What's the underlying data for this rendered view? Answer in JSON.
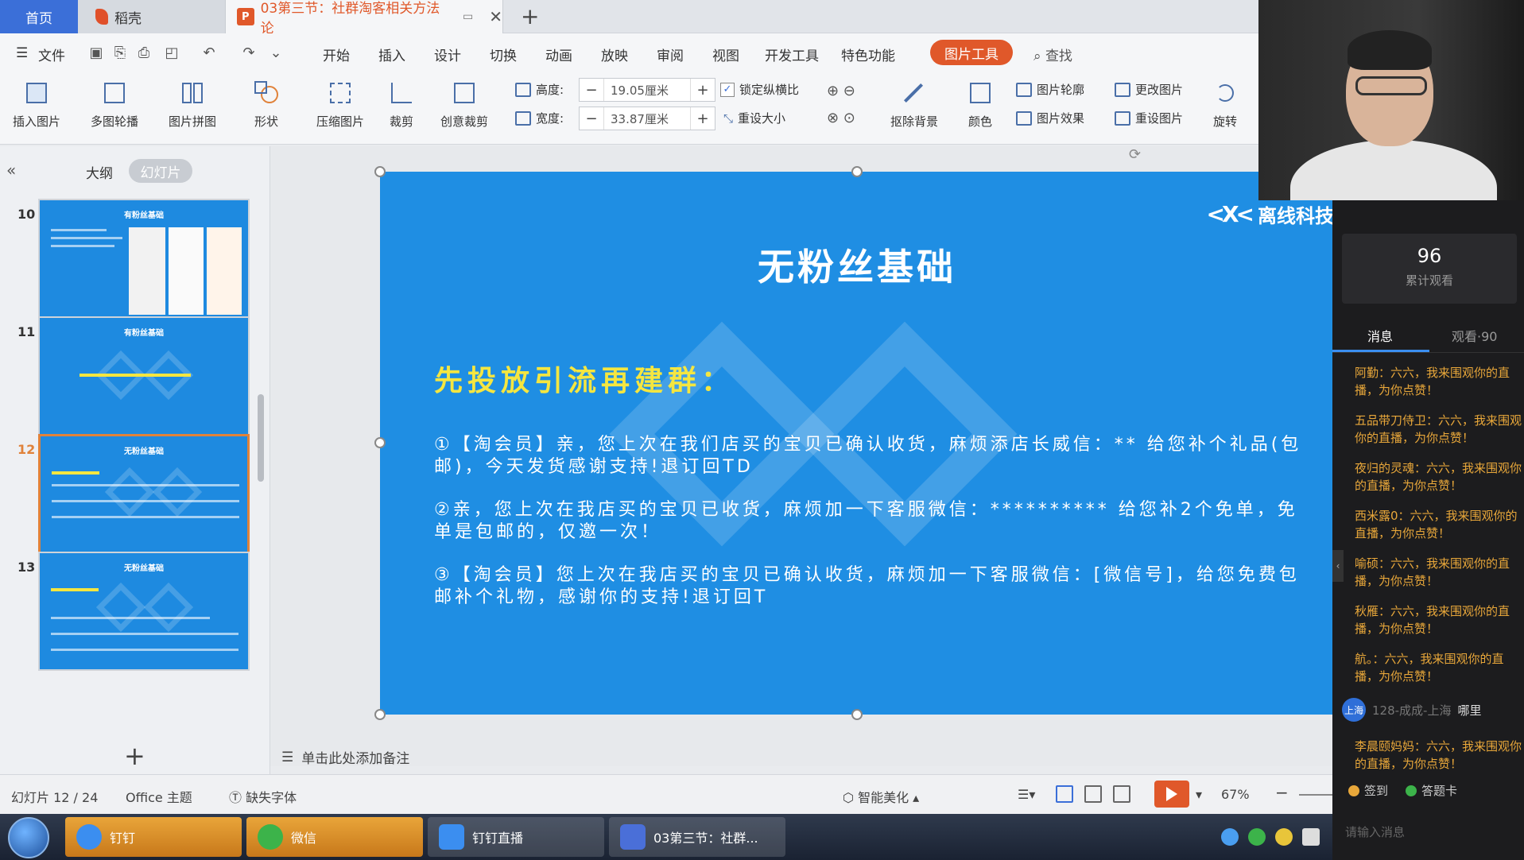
{
  "tabs": {
    "home": "首页",
    "daoke": "稻壳",
    "doc": "03第三节：社群淘客相关方法论",
    "doc_badge": "P"
  },
  "menu": {
    "file": "文件",
    "tabs": [
      "开始",
      "插入",
      "设计",
      "切换",
      "动画",
      "放映",
      "审阅",
      "视图",
      "开发工具",
      "特色功能"
    ],
    "picture_tool": "图片工具",
    "search": "查找"
  },
  "ribbon": {
    "insert_picture": "插入图片",
    "multi_carousel": "多图轮播",
    "picture_collage": "图片拼图",
    "shape": "形状",
    "compress": "压缩图片",
    "crop": "裁剪",
    "creative_crop": "创意裁剪",
    "height_label": "高度:",
    "height_value": "19.05厘米",
    "width_label": "宽度:",
    "width_value": "33.87厘米",
    "lock_ratio": "锁定纵横比",
    "reset_size": "重设大小",
    "remove_bg": "抠除背景",
    "color": "颜色",
    "outline": "图片轮廓",
    "effect": "图片效果",
    "change": "更改图片",
    "reset_picture": "重设图片",
    "rotate": "旋转"
  },
  "left_panel": {
    "outline_tab": "大纲",
    "slides_tab": "幻灯片",
    "thumbnails": [
      {
        "num": "10",
        "title": "有粉丝基础"
      },
      {
        "num": "11",
        "title": "有粉丝基础"
      },
      {
        "num": "12",
        "title": "无粉丝基础"
      },
      {
        "num": "13",
        "title": "无粉丝基础"
      }
    ]
  },
  "slide": {
    "logo": "离线科技",
    "logo_mark": "<X<",
    "title": "无粉丝基础",
    "subtitle": "先投放引流再建群：",
    "p1": "①【淘会员】亲，您上次在我们店买的宝贝已确认收货，麻烦添店长威信：** 给您补个礼品(包邮)，今天发货感谢支持!退订回TD",
    "p2": "②亲，您上次在我店买的宝贝已收货，麻烦加一下客服微信：********** 给您补2个免单，免单是包邮的，仅邀一次！",
    "p3": "③【淘会员】您上次在我店买的宝贝已确认收货，麻烦加一下客服微信：[微信号]，给您免费包邮补个礼物，感谢你的支持!退订回T"
  },
  "notes_placeholder": "单击此处添加备注",
  "status": {
    "slide_pos": "幻灯片 12 / 24",
    "theme": "Office 主题",
    "missing_font": "缺失字体",
    "beautify": "智能美化",
    "zoom": "67%"
  },
  "taskbar": {
    "dingding": "钉钉",
    "wechat": "微信",
    "dingding_live": "钉钉直播",
    "wps_doc": "03第三节：社群..."
  },
  "live": {
    "viewer_count": "96",
    "viewer_label": "累计观看",
    "tab_messages": "消息",
    "tab_watching": "观看·90",
    "messages": [
      {
        "name": "阿勤",
        "text": "：六六，我来围观你的直播，为你点赞！"
      },
      {
        "name": "五品带刀侍卫",
        "text": "：六六，我来围观你的直播，为你点赞！"
      },
      {
        "name": "夜归的灵魂",
        "text": "：六六，我来围观你的直播，为你点赞！"
      },
      {
        "name": "西米露0",
        "text": "：六六，我来围观你的直播，为你点赞！"
      },
      {
        "name": "喻硕",
        "text": "：六六，我来围观你的直播，为你点赞！"
      },
      {
        "name": "秋雁",
        "text": "：六六，我来围观你的直播，为你点赞！"
      },
      {
        "name": "航。",
        "text": "：六六，我来围观你的直播，为你点赞！"
      }
    ],
    "join_badge": "上海",
    "join_text": "128-成成-上海",
    "join_who": "哪里",
    "last_message": {
      "name": "李晨颐妈妈",
      "text": "：六六，我来围观你的直播，为你点赞！"
    },
    "checkin": "签到",
    "answer_card": "答题卡",
    "input_placeholder": "请输入消息"
  },
  "colors": {
    "accent": "#e0582a",
    "slide_bg": "#1f8ee3",
    "slide_yellow": "#f5e640",
    "chat_name": "#e8a73a"
  }
}
